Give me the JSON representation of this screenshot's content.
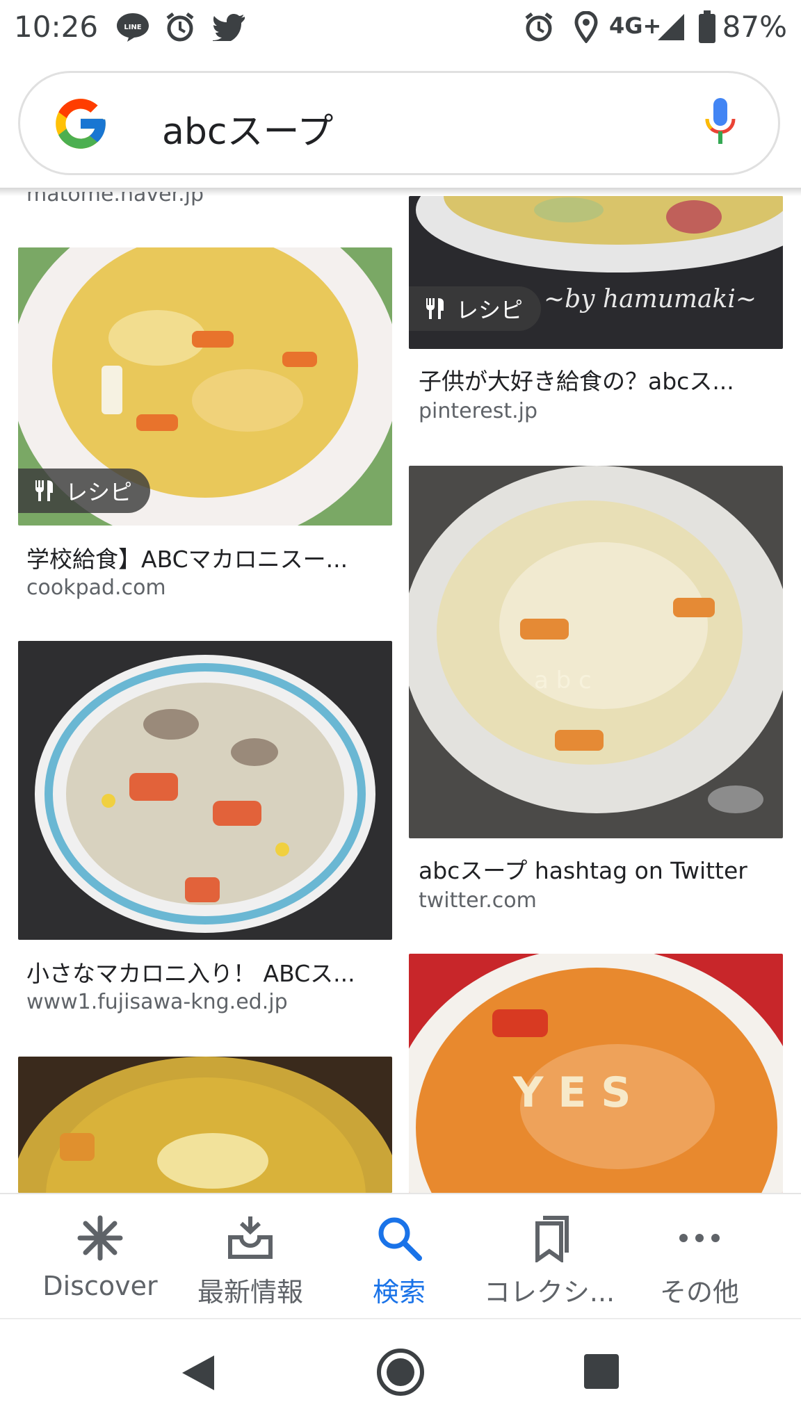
{
  "status_bar": {
    "time": "10:26",
    "network": "4G+",
    "battery": "87%"
  },
  "search": {
    "query": "abcスープ"
  },
  "results": [
    {
      "source": "matome.naver.jp"
    },
    {
      "badge": "レシピ",
      "title": "学校給食】ABCマカロニスー...",
      "source": "cookpad.com"
    },
    {
      "title": "小さなマカロニ入り！ ABCス...",
      "source": "www1.fujisawa-kng.ed.jp"
    },
    {
      "badge": "レシピ",
      "watermark": "~by hamumaki~",
      "title": "子供が大好き給食の？abcス...",
      "source": "pinterest.jp"
    },
    {
      "title": "abcスープ hashtag on Twitter",
      "source": "twitter.com"
    }
  ],
  "bottom_nav": [
    {
      "label": "Discover",
      "icon": "asterisk-icon"
    },
    {
      "label": "最新情報",
      "icon": "updates-tray-icon"
    },
    {
      "label": "検索",
      "icon": "search-icon",
      "active": true
    },
    {
      "label": "コレクシ...",
      "icon": "collections-icon"
    },
    {
      "label": "その他",
      "icon": "more-icon"
    }
  ],
  "colors": {
    "accent": "#1a73e8",
    "text": "#202124",
    "muted": "#5f6368"
  }
}
